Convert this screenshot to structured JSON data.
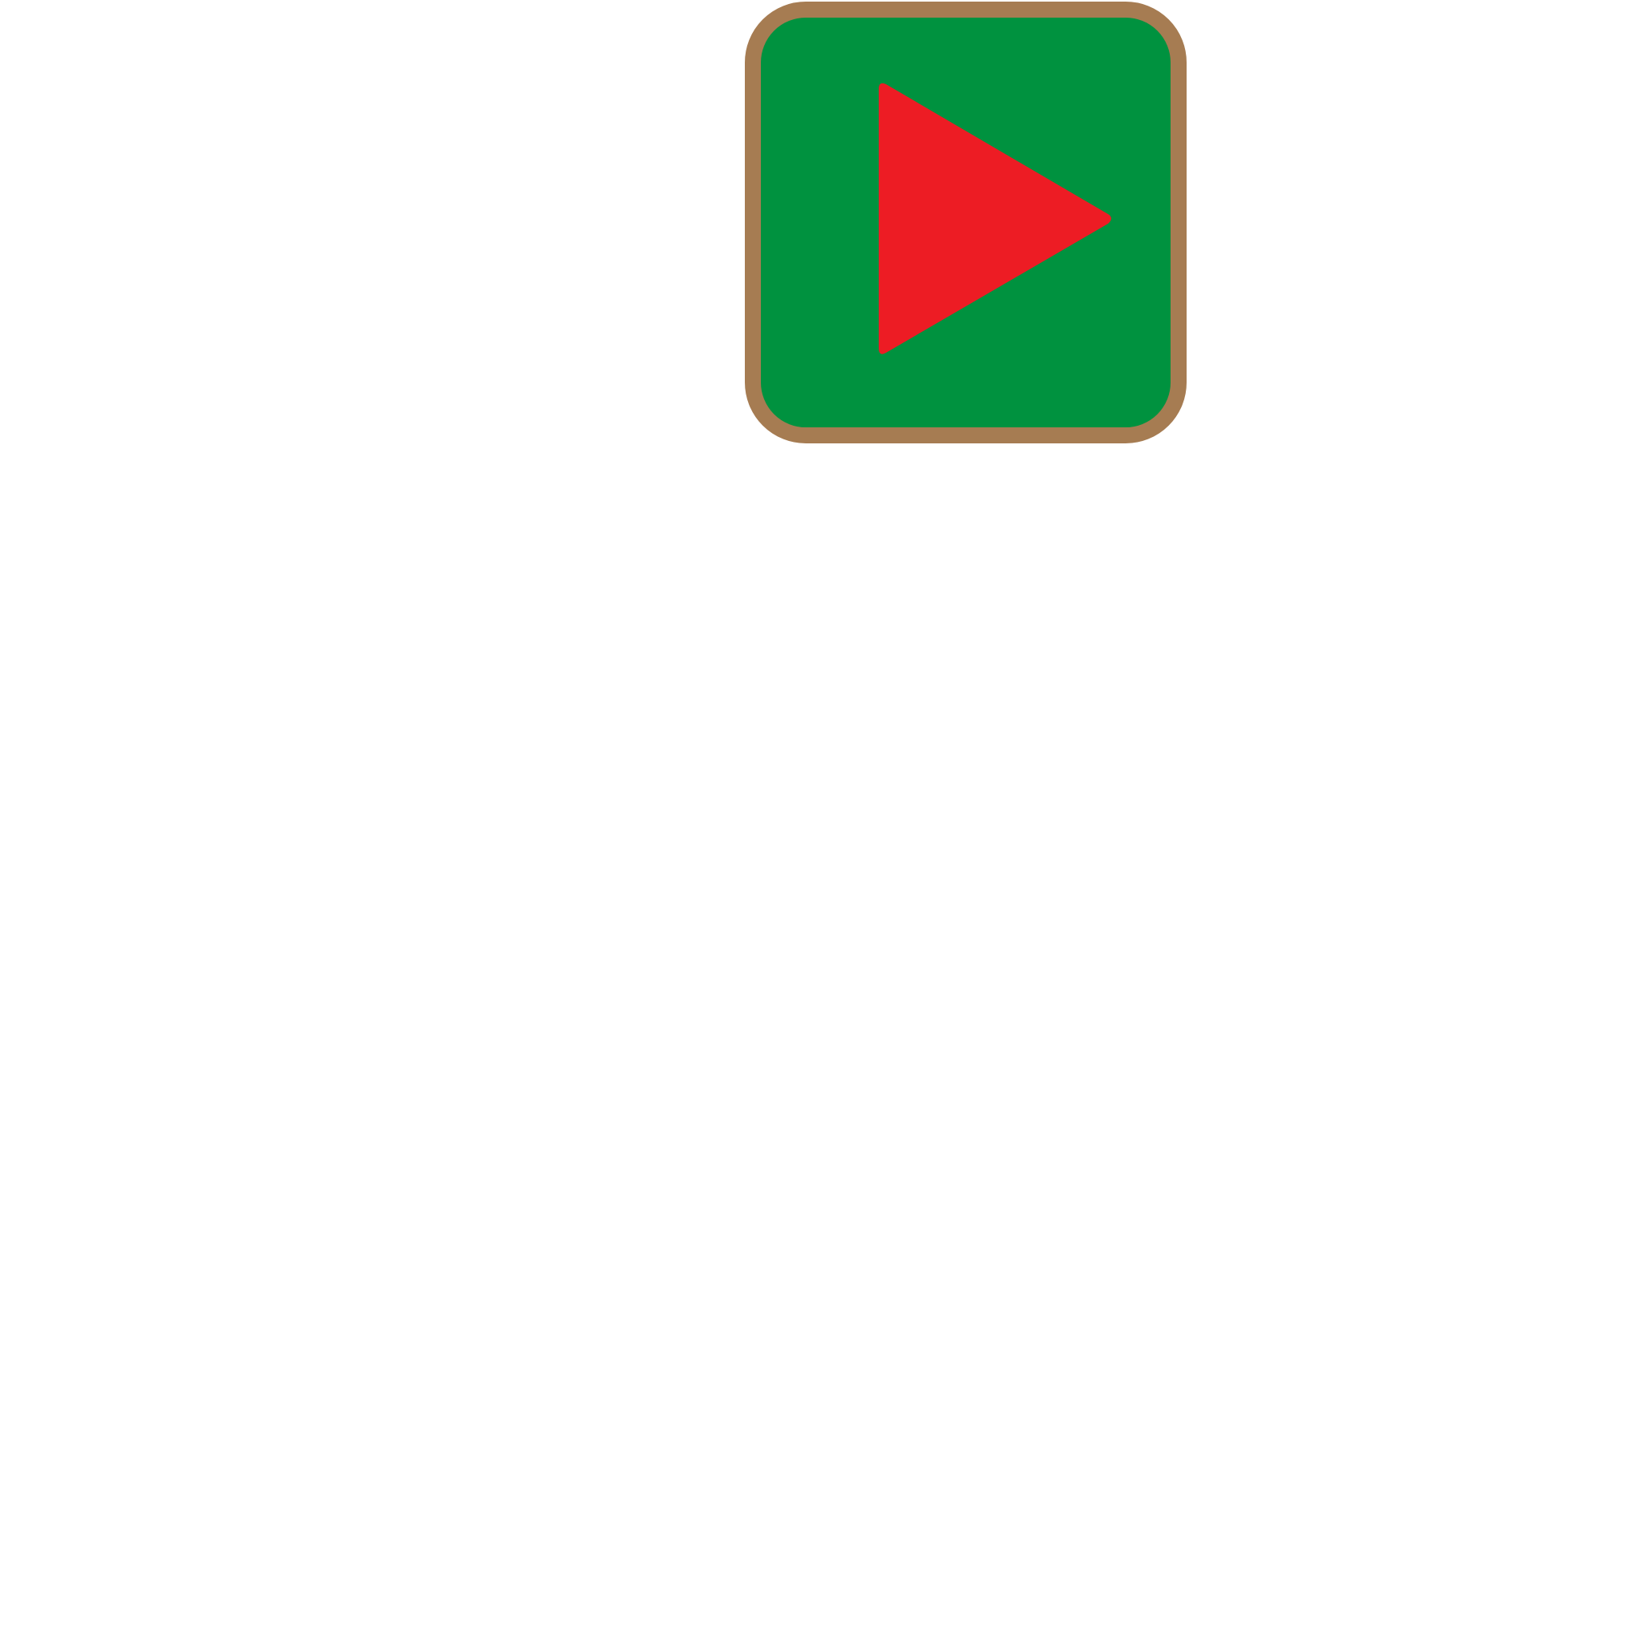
{
  "play_button": {
    "icon": "play-icon",
    "colors": {
      "background": "#00923F",
      "border": "#A67C52",
      "triangle": "#ED1C24"
    }
  },
  "page": {
    "background": "#FFFFFF"
  }
}
